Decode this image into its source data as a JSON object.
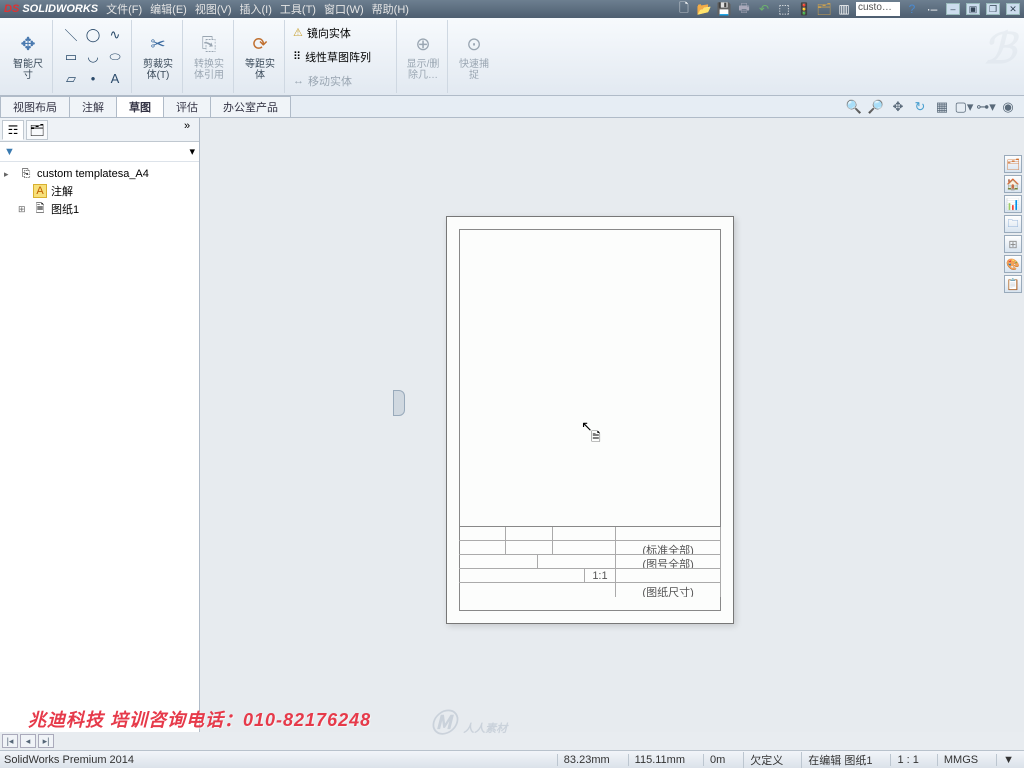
{
  "titlebar": {
    "logo_ds": "DS",
    "logo_txt": "SOLIDWORKS",
    "menus": [
      "文件(F)",
      "编辑(E)",
      "视图(V)",
      "插入(I)",
      "工具(T)",
      "窗口(W)",
      "帮助(H)"
    ],
    "search_text": "custo…",
    "help_icon": "?"
  },
  "ribbon": {
    "smart_dim": "智能尺\n寸",
    "trim": "剪裁实\n体(T)",
    "convert": "转换实\n体引用",
    "offset": "等距实\n体",
    "mirror": "镜向实体",
    "linear_pattern": "线性草图阵列",
    "move": "移动实体",
    "show_hide": "显示/删\n除几…",
    "quick_snap": "快速捕\n捉"
  },
  "tabs": [
    "视图布局",
    "注解",
    "草图",
    "评估",
    "办公室产品"
  ],
  "active_tab": 2,
  "tree": {
    "root": "custom templatesa_A4",
    "items": [
      "注解",
      "图纸1"
    ]
  },
  "drawing": {
    "tb_scale": "1:1",
    "tb_label1": "(标准全部)",
    "tb_label2": "(图号全部)",
    "tb_label3": "(图纸尺寸)"
  },
  "overlay": {
    "company": "兆迪科技  培训咨询电话：010-82176248",
    "watermark": "人人素材"
  },
  "status": {
    "app": "SolidWorks Premium 2014",
    "x": "83.23mm",
    "y": "115.11mm",
    "z": "0m",
    "def": "欠定义",
    "editing": "在编辑 图纸1",
    "scale": "1 : 1",
    "units": "MMGS"
  }
}
